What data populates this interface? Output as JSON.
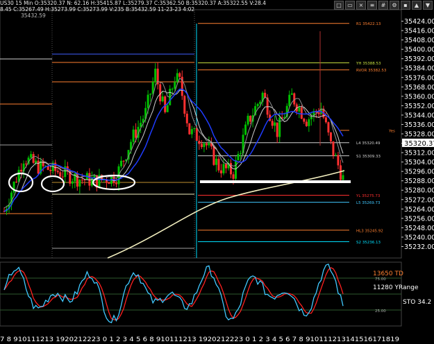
{
  "header": {
    "line1": "US30  15 Min   O:35320.37  N:  62.16  H:35415.87  L:35279.37  C:35362.50  B:35320.37  A:35322.55  V:28.4",
    "line2": "8.45   C:35267.49  H:35273.99  C:35273.99  V:235  B:35432.59  11-23-23  4:02",
    "line3": "35432.59"
  },
  "toolbar_icons": [
    "maximize-icon",
    "restore-icon",
    "close-icon",
    "menu-icon",
    "grid-icon",
    "settings-icon",
    "lock-icon",
    "up-icon",
    "down-icon"
  ],
  "colors": {
    "bull": "#00c000",
    "bear": "#ff3030",
    "ma_blue": "#1f3cff",
    "ma_white": "#d0d0d0",
    "ma_slow": "#f4f0c0",
    "orange": "#ff8030",
    "cyan": "#00e0ff",
    "yellowgreen": "#c8e040",
    "stoch_fast": "#40c8ff",
    "stoch_slow": "#ff2020"
  },
  "price_axis": {
    "min": 35224,
    "max": 35432,
    "labels": [
      "35424.00",
      "35416.00",
      "35408.00",
      "35400.00",
      "35392.00",
      "35384.00",
      "35376.00",
      "35368.00",
      "35360.00",
      "35352.00",
      "35344.00",
      "35336.00",
      "35328.00",
      "35320.00",
      "35312.00",
      "35304.00",
      "35296.00",
      "35288.00",
      "35280.00",
      "35272.00",
      "35264.00",
      "35256.00",
      "35248.00",
      "35240.00",
      "35232.00"
    ],
    "last_price": "35320.37"
  },
  "level_lines": [
    {
      "label": "R1  35422.13",
      "price": 35422.13,
      "color": "#ff8030"
    },
    {
      "label": "YH  35388.53",
      "price": 35388.53,
      "color": "#c8e040"
    },
    {
      "label": "RVOR  35382.53",
      "price": 35382.53,
      "color": "#ff8030"
    },
    {
      "label": "Yes",
      "price": 35331,
      "color": "#ff8030"
    },
    {
      "label": "L4  35320.49",
      "price": 35320.49,
      "color": "#d0d0d0"
    },
    {
      "label": "S1  35309.33",
      "price": 35309.33,
      "color": "#d0d0d0"
    },
    {
      "label": "YL  35275.73",
      "price": 35275.73,
      "color": "#ff3030"
    },
    {
      "label": "L5  35269.73",
      "price": 35269.73,
      "color": "#40c8ff"
    },
    {
      "label": "HL3  35245.92",
      "price": 35245.92,
      "color": "#ff8030"
    },
    {
      "label": "S2  35236.13",
      "price": 35236.13,
      "color": "#00e0ff"
    }
  ],
  "oscillator": {
    "top_label": "13650 TD",
    "mid_label": "11280 YRange",
    "stoch_label": "STO  34.2",
    "level_75": "75.00",
    "level_25": "25.00"
  },
  "time_axis": {
    "labels": "7 8 910111213 1920212223 0 1 2 3 4 5 6 8 910111213 1920212223 0 1 2 3 4 5 6 7 8 910111213141516171819"
  }
}
